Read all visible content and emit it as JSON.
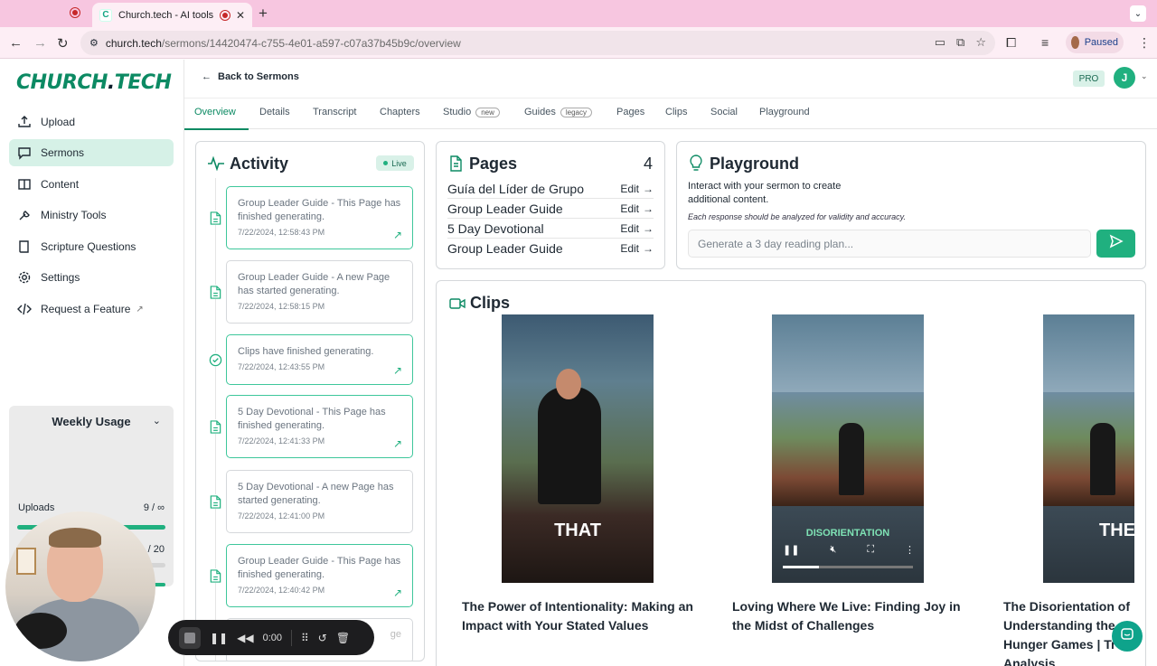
{
  "browser": {
    "tab_title": "Church.tech - AI tools tha",
    "tab_favicon": "C",
    "url_host": "church.tech",
    "url_path": "/sermons/14420474-c755-4e01-a597-c07a37b45b9c/overview",
    "profile_status": "Paused"
  },
  "sidebar": {
    "logo_main": "CHURCH",
    "logo_dot": ".",
    "logo_tail": "TECH",
    "items": [
      {
        "label": "Upload",
        "icon": "upload-icon"
      },
      {
        "label": "Sermons",
        "icon": "chat-icon"
      },
      {
        "label": "Content",
        "icon": "content-icon"
      },
      {
        "label": "Ministry Tools",
        "icon": "tools-icon"
      },
      {
        "label": "Scripture Questions",
        "icon": "book-icon"
      },
      {
        "label": "Settings",
        "icon": "gear-icon"
      },
      {
        "label": "Request a Feature",
        "icon": "code-icon"
      }
    ],
    "usage": {
      "title": "Weekly Usage",
      "uploads_label": "Uploads",
      "uploads_value": "9 / ∞",
      "uploads_fill": 1.0,
      "second_value": "/ 20",
      "second_fill": 0.9
    }
  },
  "recorder": {
    "time": "0:00"
  },
  "header": {
    "back_label": "Back to Sermons",
    "plan_badge": "PRO",
    "user_initial": "J"
  },
  "tabs": [
    {
      "label": "Overview",
      "pill": ""
    },
    {
      "label": "Details",
      "pill": ""
    },
    {
      "label": "Transcript",
      "pill": ""
    },
    {
      "label": "Chapters",
      "pill": ""
    },
    {
      "label": "Studio",
      "pill": "new"
    },
    {
      "label": "Guides",
      "pill": "legacy"
    },
    {
      "label": "Pages",
      "pill": ""
    },
    {
      "label": "Clips",
      "pill": ""
    },
    {
      "label": "Social",
      "pill": ""
    },
    {
      "label": "Playground",
      "pill": ""
    }
  ],
  "activity": {
    "title": "Activity",
    "live_label": "Live",
    "items": [
      {
        "message": "Group Leader Guide - This Page has finished generating.",
        "time": "7/22/2024, 12:58:43 PM",
        "icon": "document-icon"
      },
      {
        "message": "Group Leader Guide - A new Page has started generating.",
        "time": "7/22/2024, 12:58:15 PM",
        "icon": "document-icon"
      },
      {
        "message": "Clips have finished generating.",
        "time": "7/22/2024, 12:43:55 PM",
        "icon": "check-circle-icon"
      },
      {
        "message": "5 Day Devotional - This Page has finished generating.",
        "time": "7/22/2024, 12:41:33 PM",
        "icon": "document-icon"
      },
      {
        "message": "5 Day Devotional - A new Page has started generating.",
        "time": "7/22/2024, 12:41:00 PM",
        "icon": "document-icon"
      },
      {
        "message": "Group Leader Guide - This Page has finished generating.",
        "time": "7/22/2024, 12:40:42 PM",
        "icon": "document-icon"
      }
    ],
    "partial_text": "ge"
  },
  "pages": {
    "title": "Pages",
    "count": "4",
    "edit_label": "Edit",
    "items": [
      "Guía del Líder de Grupo",
      "Group Leader Guide",
      "5 Day Devotional",
      "Group Leader Guide"
    ]
  },
  "playground": {
    "title": "Playground",
    "description": "Interact with your sermon to create additional content.",
    "note": "Each response should be analyzed for validity and accuracy.",
    "placeholder": "Generate a 3 day reading plan..."
  },
  "clips": {
    "title": "Clips",
    "items": [
      {
        "title": "The Power of Intentionality: Making an Impact with Your Stated Values",
        "caption": "THAT"
      },
      {
        "title": "Loving Where We Live: Finding Joy in the Midst of Challenges",
        "caption": "DISORIENTATION"
      },
      {
        "title": "The Disorientation of Understanding the Hunger Games | Tr Analysis",
        "caption": "THE"
      }
    ]
  },
  "colors": {
    "brand": "#0c8a63",
    "accent": "#20b07f",
    "browser_tab": "#f7c6e0"
  }
}
